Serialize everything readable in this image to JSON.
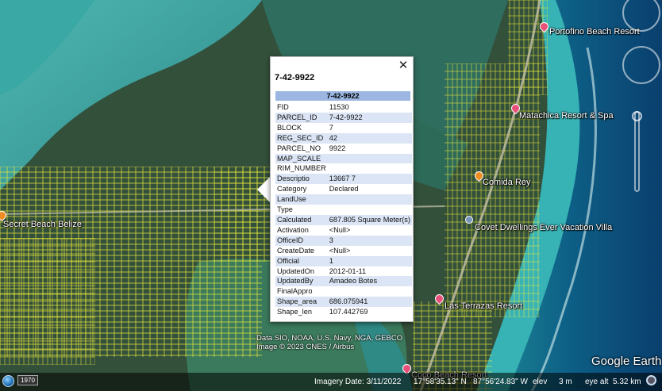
{
  "popup": {
    "close_label": "✕",
    "title": "7-42-9922",
    "header": "7-42-9922",
    "rows": [
      {
        "key": "FID",
        "value": "11530"
      },
      {
        "key": "PARCEL_ID",
        "value": "7-42-9922"
      },
      {
        "key": "BLOCK",
        "value": "7"
      },
      {
        "key": "REG_SEC_ID",
        "value": "42"
      },
      {
        "key": "PARCEL_NO",
        "value": "9922"
      },
      {
        "key": "MAP_SCALE",
        "value": ""
      },
      {
        "key": "RIM_NUMBER",
        "value": ""
      },
      {
        "key": "Descriptio",
        "value": "13667 7"
      },
      {
        "key": "Category",
        "value": "Declared"
      },
      {
        "key": "LandUse",
        "value": ""
      },
      {
        "key": "Type",
        "value": ""
      },
      {
        "key": "Calculated",
        "value": "687.805 Square Meter(s)"
      },
      {
        "key": "Activation",
        "value": "<Null>"
      },
      {
        "key": "OfficeID",
        "value": "3"
      },
      {
        "key": "CreateDate",
        "value": "<Null>"
      },
      {
        "key": "Official",
        "value": "1"
      },
      {
        "key": "UpdatedOn",
        "value": "2012-01-11"
      },
      {
        "key": "UpdatedBy",
        "value": "Amadeo Botes"
      },
      {
        "key": "FinalAppro",
        "value": ""
      },
      {
        "key": "Shape_area",
        "value": "686.075941"
      },
      {
        "key": "Shape_len",
        "value": "107.442769"
      }
    ]
  },
  "places": {
    "portofino": "Portofino Beach Resort",
    "matachica": "Matachica Resort & Spa",
    "comida": "Comida Rey",
    "covet": "Covet Dwellings Ever Vacation Villa",
    "secret_beach": "Secret Beach Belize",
    "las_terrazas": "Las Terrazas Resort",
    "coco_beach": "Coco Beach Resort"
  },
  "attribution": {
    "line1": "Data SIO, NOAA, U.S. Navy, NGA, GEBCO",
    "line2": "Image © 2023 CNES / Airbus"
  },
  "logo": "Google Earth",
  "status": {
    "year": "1970",
    "imagery_date": "Imagery Date: 3/11/2022",
    "lat": "17°58'35.13\" N",
    "lon": "87°56'24.83\" W",
    "elev_label": "elev",
    "elev_value": "3 m",
    "eye_alt_label": "eye alt",
    "eye_alt_value": "5.32 km"
  },
  "colors": {
    "parcel_lines": "#e8e83a",
    "header_bg": "#9bb6e0",
    "row_alt_bg": "#dbe5f5"
  }
}
